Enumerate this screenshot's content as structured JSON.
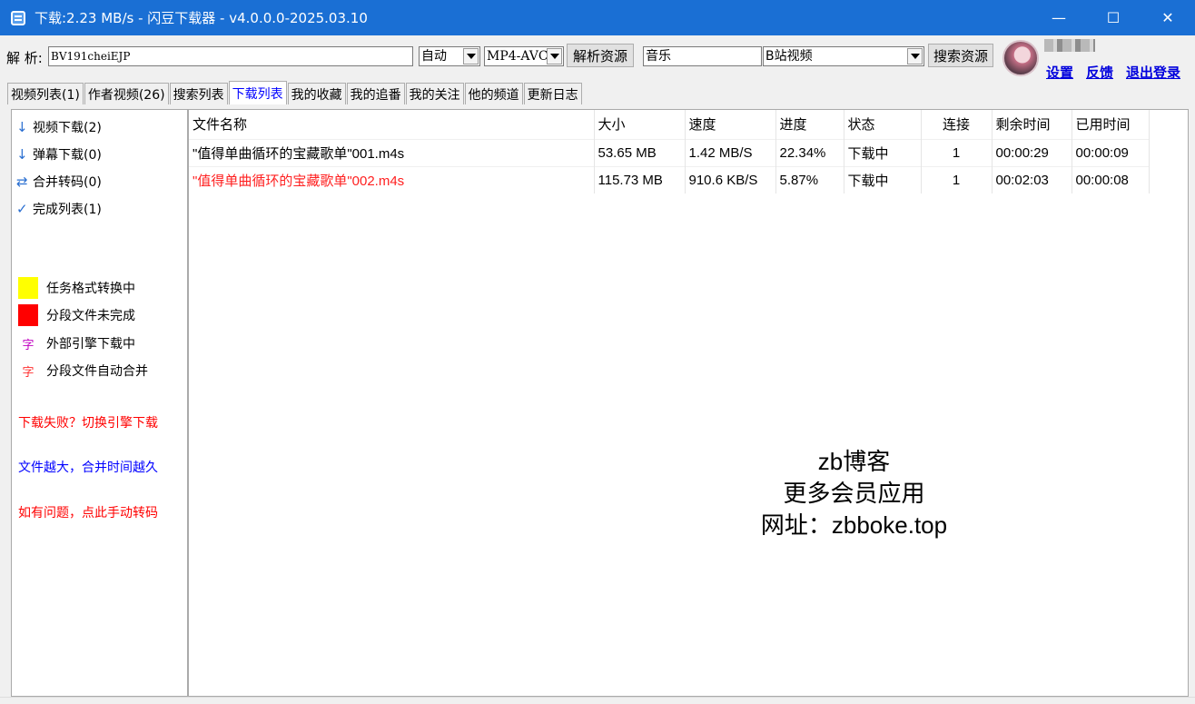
{
  "window": {
    "title": "下载:2.23 MB/s - 闪豆下载器 - v4.0.0.0-2025.03.10",
    "minimize": "—",
    "maximize": "☐",
    "close": "✕"
  },
  "toolbar": {
    "parse_label": "解 析:",
    "url_value": "BV191cheiEJP",
    "quality_value": "自动",
    "codec_value": "MP4-AVC",
    "parse_button": "解析资源",
    "search_value": "音乐",
    "site_value": "B站视频",
    "search_button": "搜索资源",
    "settings_link": "设置",
    "feedback_link": "反馈",
    "logout_link": "退出登录"
  },
  "tabs": [
    "视频列表(1)",
    "作者视频(26)",
    "搜索列表",
    "下载列表",
    "我的收藏",
    "我的追番",
    "我的关注",
    "他的频道",
    "更新日志"
  ],
  "active_tab": "下载列表",
  "sidebar": {
    "items": [
      {
        "icon": "arrow-down-icon",
        "glyph": "↓",
        "label": "视频下载(2)"
      },
      {
        "icon": "arrow-down-icon",
        "glyph": "↓",
        "label": "弹幕下载(0)"
      },
      {
        "icon": "swap-icon",
        "glyph": "⇄",
        "label": "合并转码(0)"
      },
      {
        "icon": "check-icon",
        "glyph": "✓",
        "label": "完成列表(1)"
      }
    ],
    "legend": [
      {
        "color": "#ffff00",
        "label": "任务格式转换中"
      },
      {
        "color": "#ff0000",
        "label": "分段文件未完成"
      },
      {
        "glyph": "字",
        "glyph_color": "#c000c0",
        "label": "外部引擎下载中"
      },
      {
        "glyph": "字",
        "glyph_color": "#ff3030",
        "label": "分段文件自动合并"
      }
    ],
    "notes": [
      {
        "text": "下载失败？切换引擎下载",
        "color": "#ff0000"
      },
      {
        "text": "文件越大，合并时间越久",
        "color": "#0000ff"
      },
      {
        "text": "如有问题，点此手动转码",
        "color": "#ff0000"
      }
    ]
  },
  "downloads": {
    "columns": [
      "文件名称",
      "大小",
      "速度",
      "进度",
      "状态",
      "连接",
      "剩余时间",
      "已用时间"
    ],
    "rows": [
      {
        "name": "\"值得单曲循环的宝藏歌单\"001.m4s",
        "size": "53.65 MB",
        "speed": "1.42 MB/S",
        "progress": "22.34%",
        "status": "下载中",
        "connections": "1",
        "remaining": "00:00:29",
        "elapsed": "00:00:09",
        "error": false
      },
      {
        "name": "\"值得单曲循环的宝藏歌单\"002.m4s",
        "size": "115.73 MB",
        "speed": "910.6 KB/S",
        "progress": "5.87%",
        "status": "下载中",
        "connections": "1",
        "remaining": "00:02:03",
        "elapsed": "00:00:08",
        "error": true
      }
    ]
  },
  "watermark": {
    "line1": "zb博客",
    "line2": "更多会员应用",
    "line3": "网址：zbboke.top"
  }
}
